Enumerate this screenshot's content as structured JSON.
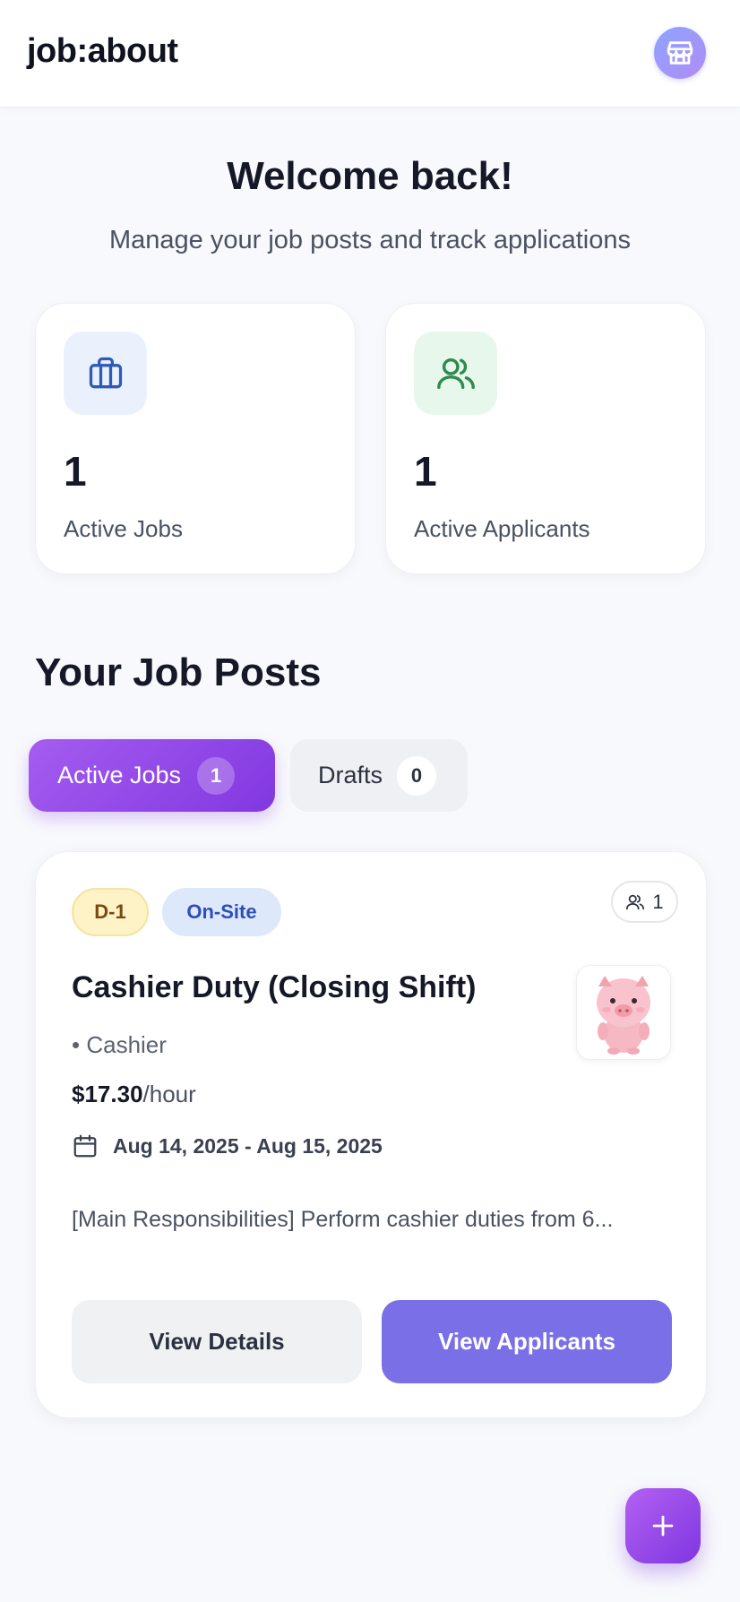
{
  "app": {
    "logo": "job:about",
    "avatar_icon": "storefront-icon"
  },
  "welcome": {
    "title": "Welcome back!",
    "subtitle": "Manage your job posts and track applications"
  },
  "stats": [
    {
      "icon": "briefcase-icon",
      "value": "1",
      "label": "Active Jobs",
      "accent": "#2f5ab8",
      "bg": "#eaf1fd"
    },
    {
      "icon": "users-icon",
      "value": "1",
      "label": "Active Applicants",
      "accent": "#2f8a4e",
      "bg": "#e7f7ec"
    }
  ],
  "section": {
    "title": "Your Job Posts"
  },
  "tabs": [
    {
      "label": "Active Jobs",
      "count": "1",
      "selected": true
    },
    {
      "label": "Drafts",
      "count": "0",
      "selected": false
    }
  ],
  "job": {
    "deadline_badge": "D-1",
    "type_badge": "On-Site",
    "applicant_count": "1",
    "title": "Cashier Duty (Closing Shift)",
    "category": "• Cashier",
    "wage_amount": "$17.30",
    "wage_unit": "/hour",
    "dates": "Aug 14, 2025 - Aug 15, 2025",
    "description": "[Main Responsibilities] Perform cashier duties from 6...",
    "thumbnail_icon": "pig-mascot-image",
    "view_details_label": "View Details",
    "view_applicants_label": "View Applicants"
  },
  "fab": {
    "icon": "plus-icon"
  },
  "colors": {
    "primary": "#8a44e6",
    "button_primary": "#7a6fe6"
  }
}
